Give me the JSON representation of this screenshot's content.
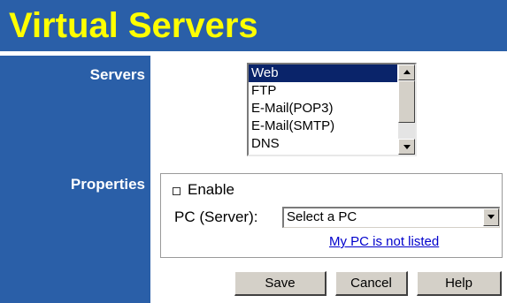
{
  "header": {
    "title": "Virtual Servers"
  },
  "sidebar": {
    "servers_label": "Servers",
    "properties_label": "Properties"
  },
  "servers": {
    "items": [
      "Web",
      "FTP",
      "E-Mail(POP3)",
      "E-Mail(SMTP)",
      "DNS"
    ],
    "selected": "Web"
  },
  "properties": {
    "enable_label": "Enable",
    "enable_checked": false,
    "pc_label": "PC (Server):",
    "pc_select_value": "Select a PC",
    "not_listed_link": "My PC is not listed"
  },
  "buttons": {
    "save": "Save",
    "cancel": "Cancel",
    "help": "Help"
  },
  "colors": {
    "header_bg": "#2a5fa8",
    "title": "#ffff00",
    "selection": "#0a246a",
    "link": "#0000cc"
  }
}
